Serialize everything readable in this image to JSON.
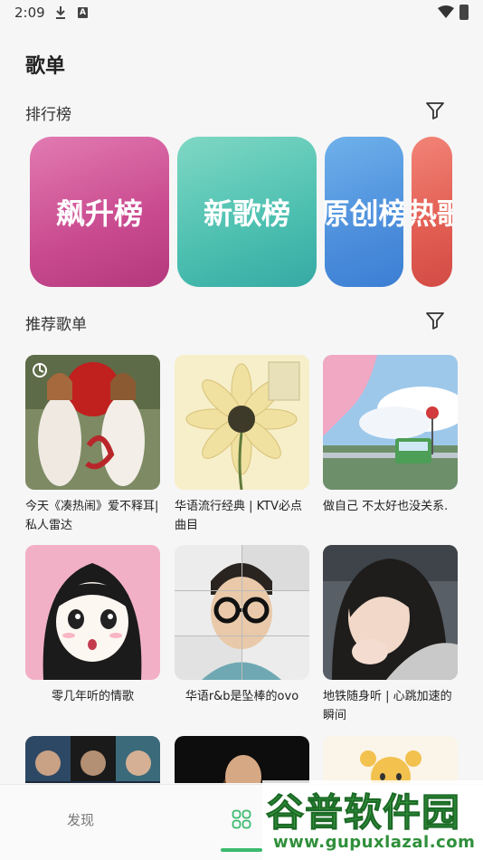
{
  "status_bar": {
    "time": "2:09",
    "badge": "A"
  },
  "page_title": "歌单",
  "charts_section": {
    "title": "排行榜",
    "cards": [
      {
        "label": "飙升榜",
        "color": "#c94a8f"
      },
      {
        "label": "新歌榜",
        "color": "#4cbfb0"
      },
      {
        "label": "原创榜",
        "color": "#4d8fdc"
      },
      {
        "label": "热歌",
        "color": "#e25d52"
      }
    ]
  },
  "recommend_section": {
    "title": "推荐歌单",
    "playlists": [
      {
        "title": "今天《凑热闹》爱不释耳|私人雷达",
        "cover": "apple-girls"
      },
      {
        "title": "华语流行经典 | KTV必点曲目",
        "cover": "daisy"
      },
      {
        "title": "做自己 不太好也没关系.",
        "cover": "anime-train"
      },
      {
        "title": "零几年听的情歌",
        "cover": "manga-girl"
      },
      {
        "title": "华语r&b是坠棒的ovo",
        "cover": "glasses-man"
      },
      {
        "title": "地铁随身听 | 心跳加速的瞬间",
        "cover": "hoodie-girl"
      }
    ]
  },
  "bottom_nav": {
    "discover_label": "发现",
    "active_color": "#3cba6e"
  },
  "watermark": {
    "main": "谷普软件园",
    "sub": "www.gupuxlazal.com"
  }
}
